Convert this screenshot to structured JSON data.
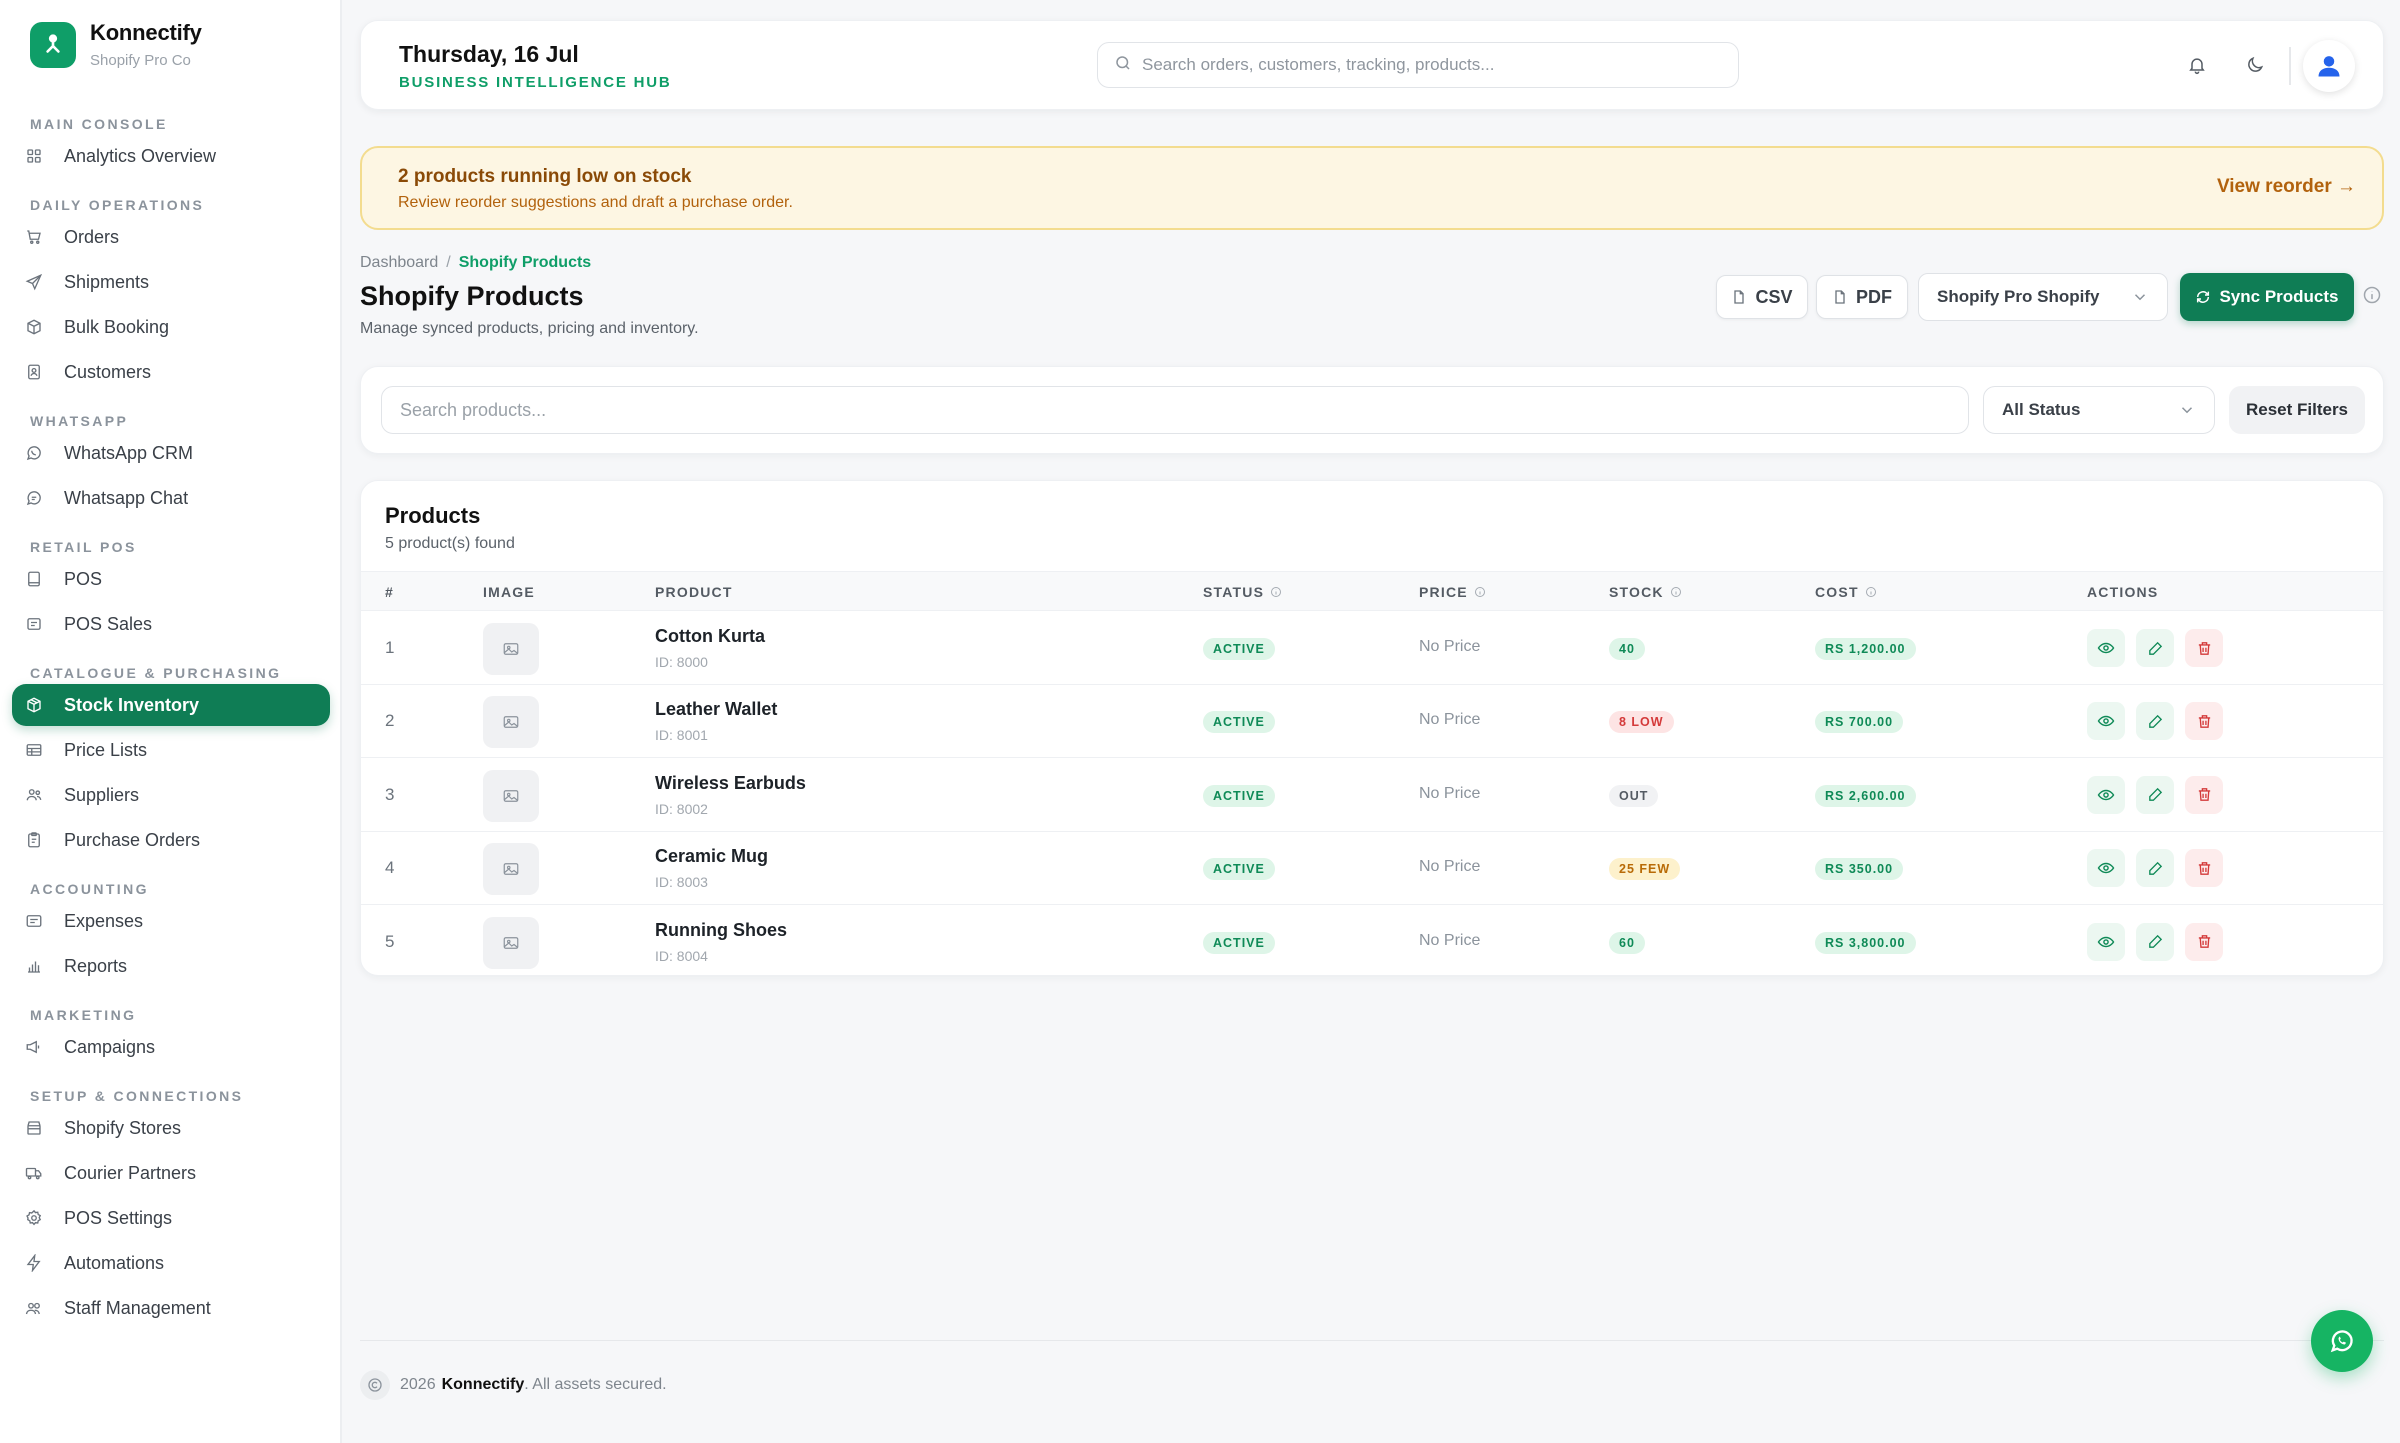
{
  "brand": {
    "name": "Konnectify",
    "subtitle": "Shopify Pro Co"
  },
  "sidebar": {
    "sections": [
      {
        "title": "MAIN CONSOLE",
        "items": [
          {
            "label": "Analytics Overview",
            "icon": "grid-icon"
          }
        ]
      },
      {
        "title": "DAILY OPERATIONS",
        "items": [
          {
            "label": "Orders",
            "icon": "cart-icon"
          },
          {
            "label": "Shipments",
            "icon": "send-icon"
          },
          {
            "label": "Bulk Booking",
            "icon": "box-icon"
          },
          {
            "label": "Customers",
            "icon": "contact-icon"
          }
        ]
      },
      {
        "title": "WHATSAPP",
        "items": [
          {
            "label": "WhatsApp CRM",
            "icon": "whatsapp-icon"
          },
          {
            "label": "Whatsapp Chat",
            "icon": "chat-icon"
          }
        ]
      },
      {
        "title": "RETAIL POS",
        "items": [
          {
            "label": "POS",
            "icon": "tablet-icon"
          },
          {
            "label": "POS Sales",
            "icon": "receipt-icon"
          }
        ]
      },
      {
        "title": "CATALOGUE & PURCHASING",
        "items": [
          {
            "label": "Stock Inventory",
            "icon": "package-icon",
            "active": true
          },
          {
            "label": "Price Lists",
            "icon": "table-icon"
          },
          {
            "label": "Suppliers",
            "icon": "users-icon"
          },
          {
            "label": "Purchase Orders",
            "icon": "clipboard-icon"
          }
        ]
      },
      {
        "title": "ACCOUNTING",
        "items": [
          {
            "label": "Expenses",
            "icon": "wallet-icon"
          },
          {
            "label": "Reports",
            "icon": "bar-chart-icon"
          }
        ]
      },
      {
        "title": "MARKETING",
        "items": [
          {
            "label": "Campaigns",
            "icon": "megaphone-icon"
          }
        ]
      },
      {
        "title": "SETUP & CONNECTIONS",
        "items": [
          {
            "label": "Shopify Stores",
            "icon": "store-icon"
          },
          {
            "label": "Courier Partners",
            "icon": "truck-icon"
          },
          {
            "label": "POS Settings",
            "icon": "gear-icon"
          },
          {
            "label": "Automations",
            "icon": "bolt-icon"
          },
          {
            "label": "Staff Management",
            "icon": "team-icon"
          }
        ]
      }
    ]
  },
  "header": {
    "date": "Thursday, 16 Jul",
    "hub": "BUSINESS INTELLIGENCE HUB",
    "search_placeholder": "Search orders, customers, tracking, products..."
  },
  "alert": {
    "title": "2 products running low on stock",
    "subtitle": "Review reorder suggestions and draft a purchase order.",
    "link": "View reorder →"
  },
  "page": {
    "breadcrumb_root": "Dashboard",
    "breadcrumb_sep": "/",
    "breadcrumb_current": "Shopify Products",
    "title": "Shopify Products",
    "subtitle": "Manage synced products, pricing and inventory.",
    "csv_label": "CSV",
    "pdf_label": "PDF",
    "store_select": "Shopify Pro Shopify",
    "sync_label": "Sync Products"
  },
  "filters": {
    "search_placeholder": "Search products...",
    "status_value": "All Status",
    "reset_label": "Reset Filters"
  },
  "products": {
    "title": "Products",
    "count_text": "5 product(s) found",
    "columns": [
      "#",
      "IMAGE",
      "PRODUCT",
      "STATUS",
      "PRICE",
      "STOCK",
      "COST",
      "ACTIONS"
    ],
    "rows": [
      {
        "index": "1",
        "name": "Cotton Kurta",
        "id": "ID: 8000",
        "status": "ACTIVE",
        "price": "No Price",
        "stock": "40",
        "stock_level": "ok",
        "cost": "RS 1,200.00"
      },
      {
        "index": "2",
        "name": "Leather Wallet",
        "id": "ID: 8001",
        "status": "ACTIVE",
        "price": "No Price",
        "stock": "8 LOW",
        "stock_level": "low",
        "cost": "RS 700.00"
      },
      {
        "index": "3",
        "name": "Wireless Earbuds",
        "id": "ID: 8002",
        "status": "ACTIVE",
        "price": "No Price",
        "stock": "OUT",
        "stock_level": "out",
        "cost": "RS 2,600.00"
      },
      {
        "index": "4",
        "name": "Ceramic Mug",
        "id": "ID: 8003",
        "status": "ACTIVE",
        "price": "No Price",
        "stock": "25 FEW",
        "stock_level": "few",
        "cost": "RS 350.00"
      },
      {
        "index": "5",
        "name": "Running Shoes",
        "id": "ID: 8004",
        "status": "ACTIVE",
        "price": "No Price",
        "stock": "60",
        "stock_level": "ok",
        "cost": "RS 3,800.00"
      }
    ]
  },
  "footer": {
    "prefix": "2026",
    "brand": "Konnectify",
    "suffix": ". All assets secured."
  },
  "colors": {
    "brand": "#0f7d55",
    "accent": "#0f9e68",
    "warning_bg": "#fdf6e3",
    "danger": "#d43a3a"
  }
}
